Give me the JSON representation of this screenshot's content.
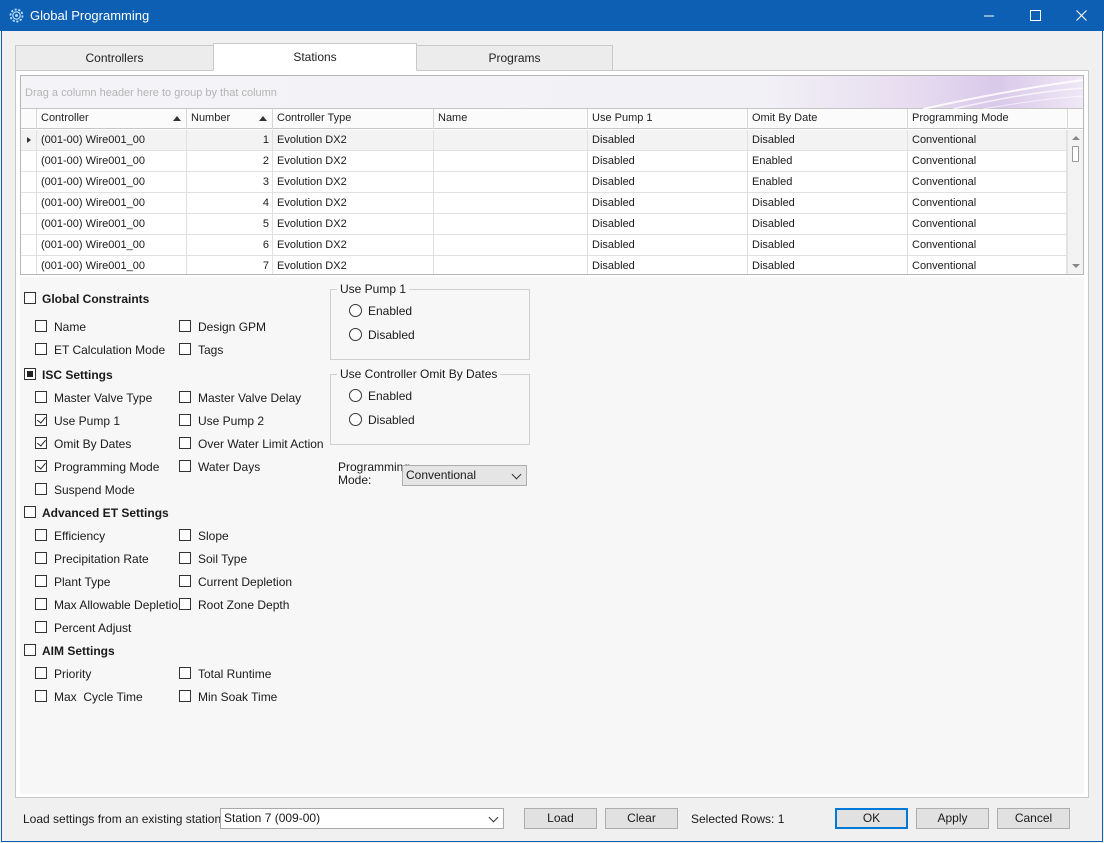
{
  "window": {
    "title": "Global Programming",
    "minimize": "—",
    "maximize": "☐",
    "close": "✕"
  },
  "tabs": [
    {
      "label": "Controllers"
    },
    {
      "label": "Stations"
    },
    {
      "label": "Programs"
    }
  ],
  "active_tab": "Stations",
  "grid": {
    "group_hint": "Drag a column header here to group by that column",
    "columns": [
      "Controller",
      "Number",
      "Controller Type",
      "Name",
      "Use Pump 1",
      "Omit By Date",
      "Programming Mode"
    ],
    "rows": [
      [
        "(001-00) Wire001_00",
        "1",
        "Evolution DX2",
        "",
        "Disabled",
        "Disabled",
        "Conventional"
      ],
      [
        "(001-00) Wire001_00",
        "2",
        "Evolution DX2",
        "",
        "Disabled",
        "Enabled",
        "Conventional"
      ],
      [
        "(001-00) Wire001_00",
        "3",
        "Evolution DX2",
        "",
        "Disabled",
        "Enabled",
        "Conventional"
      ],
      [
        "(001-00) Wire001_00",
        "4",
        "Evolution DX2",
        "",
        "Disabled",
        "Disabled",
        "Conventional"
      ],
      [
        "(001-00) Wire001_00",
        "5",
        "Evolution DX2",
        "",
        "Disabled",
        "Disabled",
        "Conventional"
      ],
      [
        "(001-00) Wire001_00",
        "6",
        "Evolution DX2",
        "",
        "Disabled",
        "Disabled",
        "Conventional"
      ],
      [
        "(001-00) Wire001_00",
        "7",
        "Evolution DX2",
        "",
        "Disabled",
        "Disabled",
        "Conventional"
      ]
    ]
  },
  "settings": {
    "global_constraints": {
      "label": "Global Constraints",
      "items": [
        {
          "label": "Name",
          "checked": false
        },
        {
          "label": "Design GPM",
          "checked": false
        },
        {
          "label": "ET Calculation Mode",
          "checked": false
        },
        {
          "label": "Tags",
          "checked": false
        }
      ]
    },
    "isc_settings": {
      "label": "ISC Settings",
      "items": [
        {
          "label": "Master Valve Type",
          "checked": false
        },
        {
          "label": "Master Valve Delay",
          "checked": false
        },
        {
          "label": "Use Pump 1",
          "checked": true
        },
        {
          "label": "Use Pump 2",
          "checked": false
        },
        {
          "label": "Omit By Dates",
          "checked": true
        },
        {
          "label": "Over Water Limit Action",
          "checked": false
        },
        {
          "label": "Programming Mode",
          "checked": true
        },
        {
          "label": "Water Days",
          "checked": false
        },
        {
          "label": "Suspend Mode",
          "checked": false
        }
      ]
    },
    "advanced_et": {
      "label": "Advanced ET Settings",
      "items": [
        {
          "label": "Efficiency",
          "checked": false
        },
        {
          "label": "Slope",
          "checked": false
        },
        {
          "label": "Precipitation Rate",
          "checked": false
        },
        {
          "label": "Soil Type",
          "checked": false
        },
        {
          "label": "Plant Type",
          "checked": false
        },
        {
          "label": "Current Depletion",
          "checked": false
        },
        {
          "label": "Max Allowable Depletion",
          "checked": false
        },
        {
          "label": "Root Zone Depth",
          "checked": false
        },
        {
          "label": "Percent Adjust",
          "checked": false
        }
      ]
    },
    "aim_settings": {
      "label": "AIM Settings",
      "items": [
        {
          "label": "Priority",
          "checked": false
        },
        {
          "label": "Total Runtime",
          "checked": false
        },
        {
          "label": "Max  Cycle Time",
          "checked": false
        },
        {
          "label": "Min Soak Time",
          "checked": false
        }
      ]
    },
    "use_pump_group": {
      "title": "Use Pump 1",
      "options": [
        "Enabled",
        "Disabled"
      ]
    },
    "omit_group": {
      "title": "Use Controller Omit By Dates",
      "options": [
        "Enabled",
        "Disabled"
      ]
    },
    "programming_mode": {
      "label_line1": "Programming",
      "label_line2": "Mode:",
      "value": "Conventional"
    }
  },
  "footer": {
    "load_label": "Load settings from an existing station:",
    "station_value": "Station 7 (009-00)",
    "load_button": "Load",
    "clear_button": "Clear",
    "selected_rows": "Selected Rows: 1",
    "ok_button": "OK",
    "apply_button": "Apply",
    "cancel_button": "Cancel"
  },
  "colors": {
    "titlebar": "#0c5fb3",
    "primary_border": "#0078d7"
  }
}
